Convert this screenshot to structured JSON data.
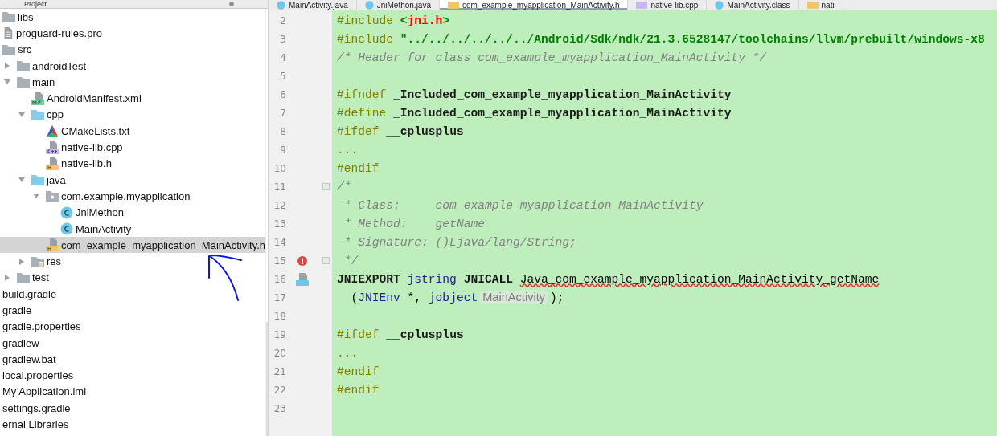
{
  "project_panel": {
    "title": "Project",
    "tree": [
      {
        "label": "libs",
        "kind": "folder",
        "selected": false
      },
      {
        "label": "proguard-rules.pro",
        "kind": "text-file",
        "selected": false
      },
      {
        "label": "src",
        "kind": "folder",
        "expanded": true,
        "selected": false,
        "children": [
          {
            "label": "androidTest",
            "kind": "folder",
            "expanded": false,
            "selected": false
          },
          {
            "label": "main",
            "kind": "folder",
            "expanded": true,
            "selected": false,
            "children": [
              {
                "label": "AndroidManifest.xml",
                "kind": "manifest",
                "selected": false
              },
              {
                "label": "cpp",
                "kind": "source-folder",
                "expanded": true,
                "selected": false,
                "children": [
                  {
                    "label": "CMakeLists.txt",
                    "kind": "cmake",
                    "selected": false
                  },
                  {
                    "label": "native-lib.cpp",
                    "kind": "cpp",
                    "selected": false
                  },
                  {
                    "label": "native-lib.h",
                    "kind": "header",
                    "selected": false
                  }
                ]
              },
              {
                "label": "java",
                "kind": "source-folder",
                "expanded": true,
                "selected": false,
                "children": [
                  {
                    "label": "com.example.myapplication",
                    "kind": "package",
                    "expanded": true,
                    "selected": false,
                    "children": [
                      {
                        "label": "JniMethon",
                        "kind": "class",
                        "selected": false
                      },
                      {
                        "label": "MainActivity",
                        "kind": "class",
                        "selected": false
                      }
                    ]
                  },
                  {
                    "label": "com_example_myapplication_MainActivity.h",
                    "kind": "header",
                    "selected": true
                  }
                ]
              },
              {
                "label": "res",
                "kind": "res-folder",
                "expanded": false,
                "selected": false
              }
            ]
          },
          {
            "label": "test",
            "kind": "folder",
            "expanded": false,
            "selected": false
          }
        ]
      },
      {
        "label": "build.gradle",
        "kind": "plain",
        "selected": false
      },
      {
        "label": "gradle",
        "kind": "plain",
        "selected": false
      },
      {
        "label": "gradle.properties",
        "kind": "plain",
        "selected": false
      },
      {
        "label": "gradlew",
        "kind": "plain",
        "selected": false
      },
      {
        "label": "gradlew.bat",
        "kind": "plain",
        "selected": false
      },
      {
        "label": "local.properties",
        "kind": "plain",
        "selected": false
      },
      {
        "label": "My Application.iml",
        "kind": "plain",
        "selected": false
      },
      {
        "label": "settings.gradle",
        "kind": "plain",
        "selected": false
      },
      {
        "label": "ernal Libraries",
        "kind": "plain",
        "selected": false
      }
    ]
  },
  "editor_tabs": [
    {
      "label": "MainActivity.java",
      "kind": "class",
      "selected": false
    },
    {
      "label": "JniMethon.java",
      "kind": "class",
      "selected": false
    },
    {
      "label": "com_example_myapplication_MainActivity.h",
      "kind": "header",
      "selected": true
    },
    {
      "label": "native-lib.cpp",
      "kind": "cpp",
      "selected": false
    },
    {
      "label": "MainActivity.class",
      "kind": "class",
      "selected": false
    },
    {
      "label": "nati",
      "kind": "header",
      "selected": false
    }
  ],
  "code_lines": [
    {
      "number": "2",
      "fold": false,
      "segments": [
        {
          "kind": "directive",
          "text": "#include "
        },
        {
          "kind": "string",
          "text": "<"
        },
        {
          "kind": "header",
          "text": "jni.h"
        },
        {
          "kind": "string",
          "text": ">"
        }
      ]
    },
    {
      "number": "3",
      "fold": false,
      "segments": [
        {
          "kind": "directive",
          "text": "#include "
        },
        {
          "kind": "string",
          "text": "\"../../../../../../Android/Sdk/ndk/21.3.6528147/toolchains/llvm/prebuilt/windows-x8"
        }
      ]
    },
    {
      "number": "4",
      "fold": false,
      "segments": [
        {
          "kind": "comment",
          "text": "/* Header for class com_example_myapplication_MainActivity */"
        }
      ]
    },
    {
      "number": "5",
      "fold": false
    },
    {
      "number": "6",
      "fold": false,
      "segments": [
        {
          "kind": "directive",
          "text": "#ifndef "
        },
        {
          "kind": "macro",
          "text": "_Included_com_example_myapplication_MainActivity"
        }
      ]
    },
    {
      "number": "7",
      "fold": false,
      "segments": [
        {
          "kind": "directive",
          "text": "#define "
        },
        {
          "kind": "macro",
          "text": "_Included_com_example_myapplication_MainActivity"
        }
      ]
    },
    {
      "number": "8",
      "fold": false,
      "segments": [
        {
          "kind": "directive",
          "text": "#ifdef "
        },
        {
          "kind": "macro",
          "text": "__cplusplus"
        }
      ]
    },
    {
      "number": "9",
      "fold": false,
      "segments": [
        {
          "kind": "directive",
          "text": "..."
        }
      ]
    },
    {
      "number": "10",
      "fold": false,
      "segments": [
        {
          "kind": "directive",
          "text": "#endif"
        }
      ]
    },
    {
      "number": "11",
      "fold": true,
      "segments": [
        {
          "kind": "comment",
          "text": "/*"
        }
      ]
    },
    {
      "number": "12",
      "fold": false,
      "segments": [
        {
          "kind": "comment",
          "text": " * Class:     com_example_myapplication_MainActivity"
        }
      ]
    },
    {
      "number": "13",
      "fold": false,
      "segments": [
        {
          "kind": "comment",
          "text": " * Method:    getName"
        }
      ]
    },
    {
      "number": "14",
      "fold": false,
      "segments": [
        {
          "kind": "comment",
          "text": " * Signature: ()Ljava/lang/String;"
        }
      ]
    },
    {
      "number": "15",
      "fold": true,
      "kind": "error",
      "segments": [
        {
          "kind": "comment",
          "text": " */"
        }
      ]
    },
    {
      "number": "16",
      "fold": false,
      "kind": "linked",
      "segments": [
        {
          "kind": "macro",
          "text": "JNIEXPORT "
        },
        {
          "kind": "type",
          "text": "jstring "
        },
        {
          "kind": "macro",
          "text": "JNICALL "
        },
        {
          "kind": "function",
          "text": "Java_com_example_myapplication_MainActivity_getName"
        }
      ]
    },
    {
      "number": "17",
      "fold": false,
      "segments": [
        {
          "kind": "plain",
          "text": "  ("
        },
        {
          "kind": "type",
          "text": "JNIEnv"
        },
        {
          "kind": "plain",
          "text": " *, "
        },
        {
          "kind": "type",
          "text": "jobject"
        },
        {
          "kind": "hint",
          "text": "MainActivity"
        },
        {
          "kind": "plain",
          "text": ");"
        }
      ]
    },
    {
      "number": "18",
      "fold": false
    },
    {
      "number": "19",
      "fold": false,
      "segments": [
        {
          "kind": "directive",
          "text": "#ifdef "
        },
        {
          "kind": "macro",
          "text": "__cplusplus"
        }
      ]
    },
    {
      "number": "20",
      "fold": false,
      "segments": [
        {
          "kind": "directive",
          "text": "..."
        }
      ]
    },
    {
      "number": "21",
      "fold": false,
      "segments": [
        {
          "kind": "directive",
          "text": "#endif"
        }
      ]
    },
    {
      "number": "22",
      "fold": false,
      "segments": [
        {
          "kind": "directive",
          "text": "#endif"
        }
      ]
    },
    {
      "number": "23",
      "fold": false
    }
  ]
}
